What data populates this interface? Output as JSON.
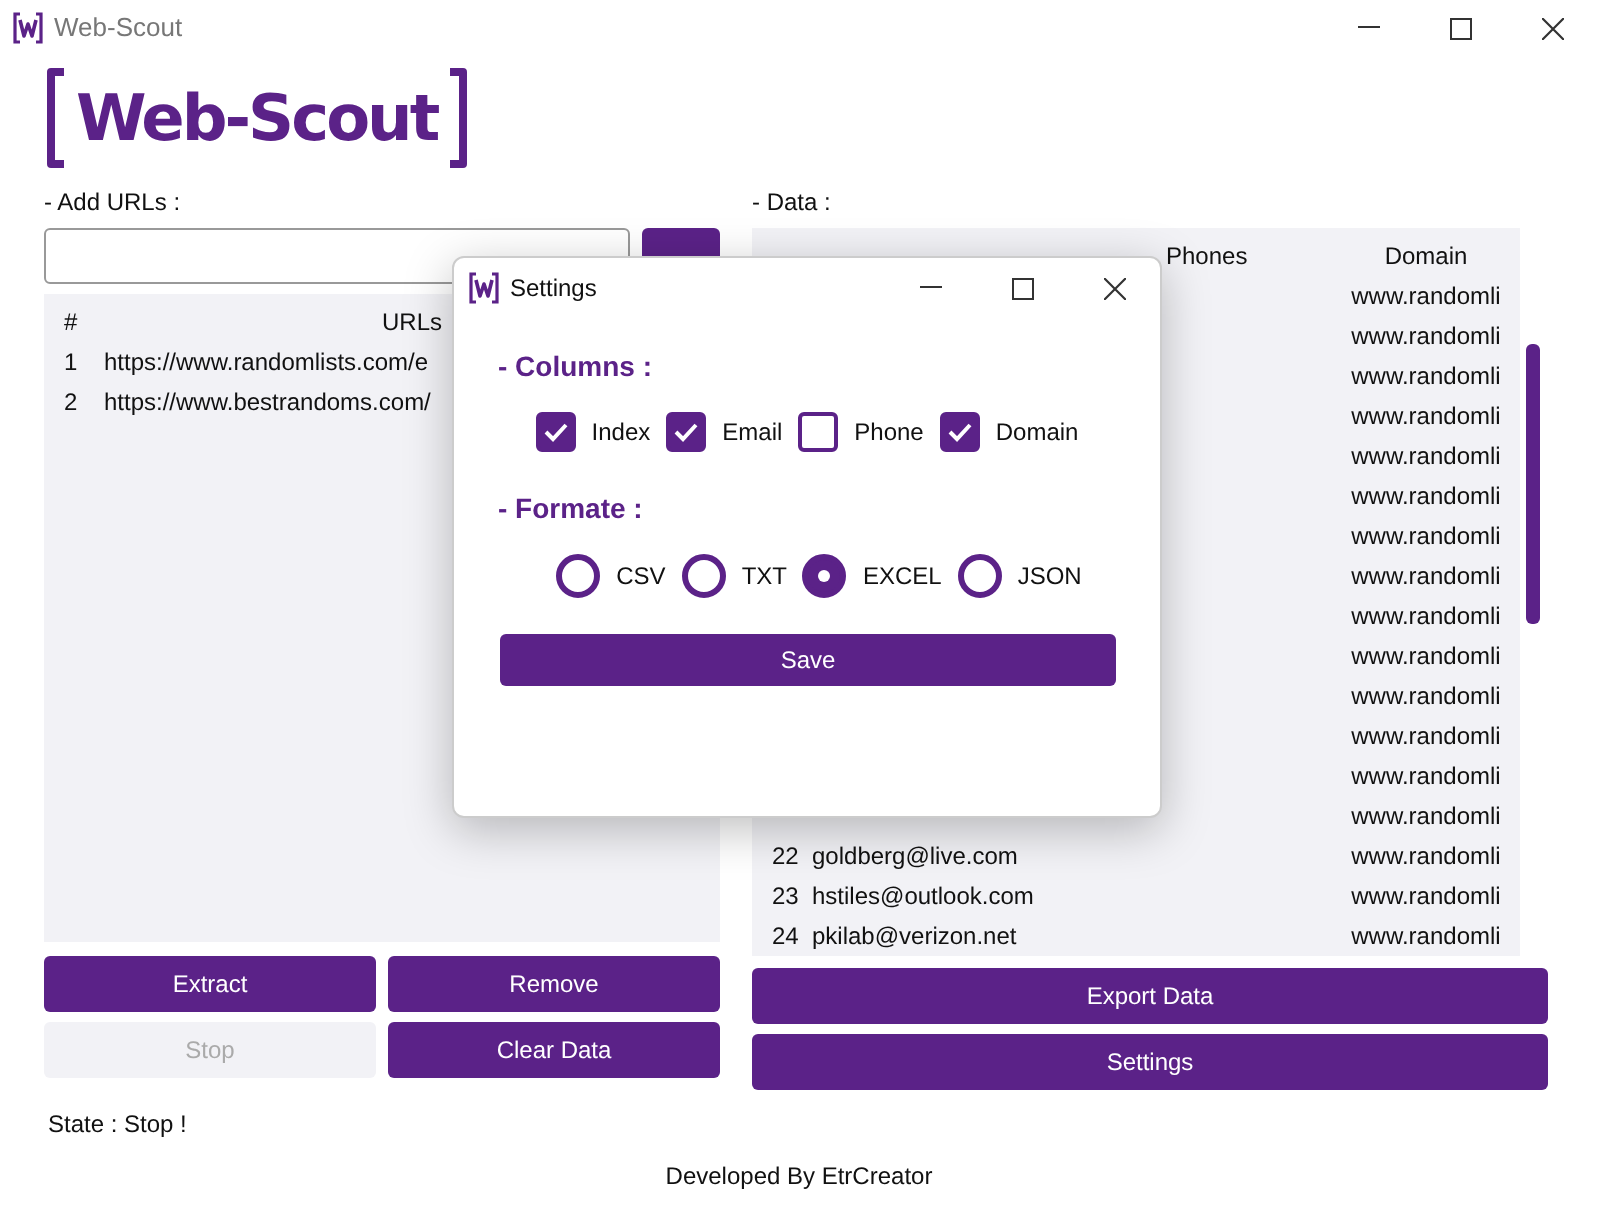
{
  "window": {
    "title": "Web-Scout"
  },
  "logo": {
    "text": "Web-Scout"
  },
  "urls_panel": {
    "label": "- Add URLs :",
    "columns": [
      "#",
      "URLs"
    ],
    "rows": [
      {
        "index": "1",
        "url": "https://www.randomlists.com/e"
      },
      {
        "index": "2",
        "url": "https://www.bestrandoms.com/"
      }
    ]
  },
  "left_buttons": [
    {
      "label": "Extract",
      "disabled": false
    },
    {
      "label": "Remove",
      "disabled": false
    },
    {
      "label": "Stop",
      "disabled": true
    },
    {
      "label": "Clear Data",
      "disabled": false
    }
  ],
  "state_text": "State : Stop !",
  "data_panel": {
    "label": "- Data :",
    "columns": [
      "Phones",
      "Domain"
    ],
    "rows": [
      {
        "domain": "www.randomli"
      },
      {
        "domain": "www.randomli"
      },
      {
        "domain": "www.randomli"
      },
      {
        "domain": "www.randomli"
      },
      {
        "domain": "www.randomli"
      },
      {
        "domain": "www.randomli"
      },
      {
        "domain": "www.randomli"
      },
      {
        "domain": "www.randomli"
      },
      {
        "domain": "www.randomli"
      },
      {
        "domain": "www.randomli"
      },
      {
        "domain": "www.randomli"
      },
      {
        "domain": "www.randomli"
      },
      {
        "domain": "www.randomli"
      },
      {
        "domain": "www.randomli"
      },
      {
        "index": "22",
        "email": "goldberg@live.com",
        "domain": "www.randomli"
      },
      {
        "index": "23",
        "email": "hstiles@outlook.com",
        "domain": "www.randomli"
      },
      {
        "index": "24",
        "email": "pkilab@verizon.net",
        "domain": "www.randomli"
      }
    ]
  },
  "right_buttons": [
    {
      "label": "Export Data"
    },
    {
      "label": "Settings"
    }
  ],
  "footer": "Developed By EtrCreator",
  "dialog": {
    "title": "Settings",
    "columns_heading": "- Columns :",
    "columns": [
      {
        "label": "Index",
        "checked": true
      },
      {
        "label": "Email",
        "checked": true
      },
      {
        "label": "Phone",
        "checked": false
      },
      {
        "label": "Domain",
        "checked": true
      }
    ],
    "format_heading": "- Formate :",
    "formats": [
      {
        "label": "CSV",
        "selected": false
      },
      {
        "label": "TXT",
        "selected": false
      },
      {
        "label": "EXCEL",
        "selected": true
      },
      {
        "label": "JSON",
        "selected": false
      }
    ],
    "save_button": "Save"
  }
}
